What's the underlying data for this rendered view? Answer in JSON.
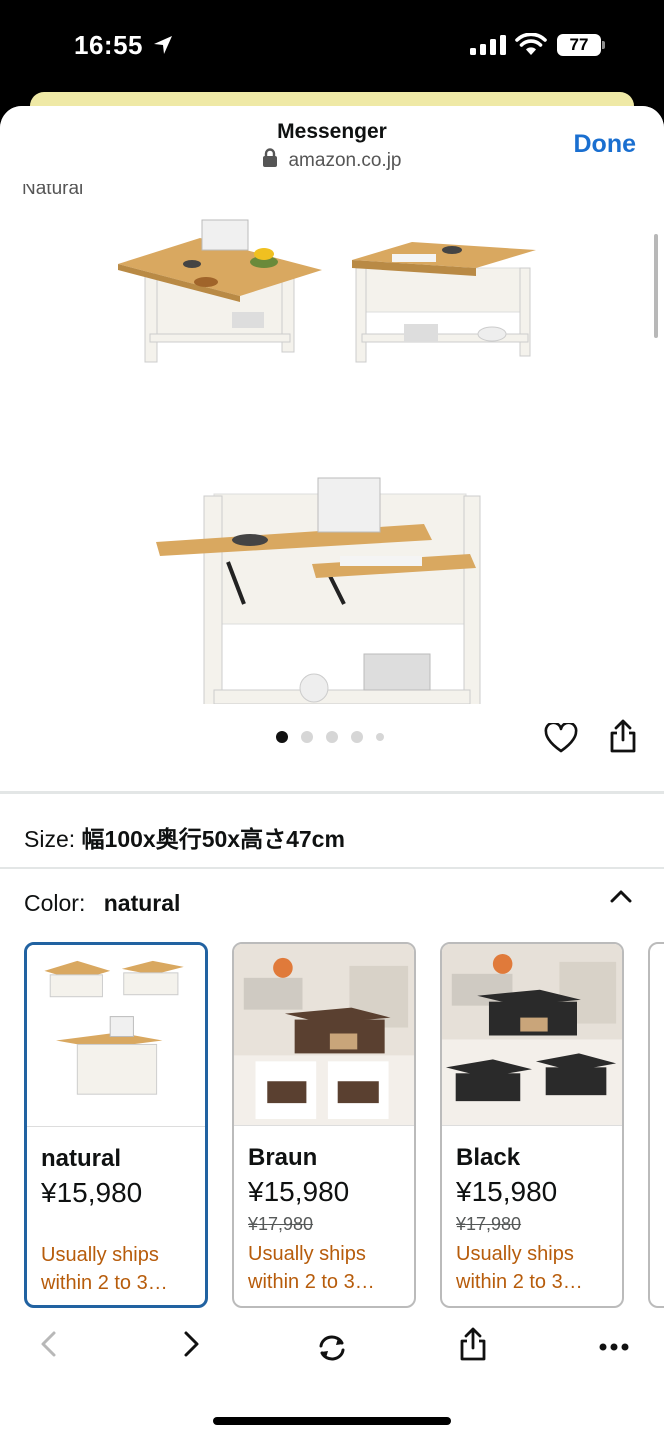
{
  "status_bar": {
    "time": "16:55",
    "battery": "77"
  },
  "header": {
    "title": "Messenger",
    "url": "amazon.co.jp",
    "done_label": "Done"
  },
  "partial_label": "Natural",
  "gallery": {
    "pages": 5,
    "current": 1
  },
  "size": {
    "label": "Size:",
    "value": "幅100x奥行50x高さ47cm"
  },
  "color": {
    "label": "Color:",
    "value": "natural"
  },
  "swatches": [
    {
      "name": "natural",
      "price": "¥15,980",
      "old_price": "",
      "ship_line1": "Usually ships",
      "ship_line2": "within 2 to 3…",
      "selected": true
    },
    {
      "name": "Braun",
      "price": "¥15,980",
      "old_price": "¥17,980",
      "ship_line1": "Usually ships",
      "ship_line2": "within 2 to 3…",
      "selected": false
    },
    {
      "name": "Black",
      "price": "¥15,980",
      "old_price": "¥17,980",
      "ship_line1": "Usually ships",
      "ship_line2": "within 2 to 3…",
      "selected": false
    }
  ],
  "colors": {
    "accent": "#1a6fd0",
    "selected_border": "#2162a1",
    "shipping": "#b75c0b",
    "wood": "#d9a860",
    "frame": "#f4f2ec"
  },
  "icons": [
    "location-arrow-icon",
    "signal-icon",
    "wifi-icon",
    "lock-icon",
    "heart-icon",
    "share-icon",
    "chevron-up-icon",
    "back-icon",
    "forward-icon",
    "reload-icon",
    "more-icon"
  ]
}
